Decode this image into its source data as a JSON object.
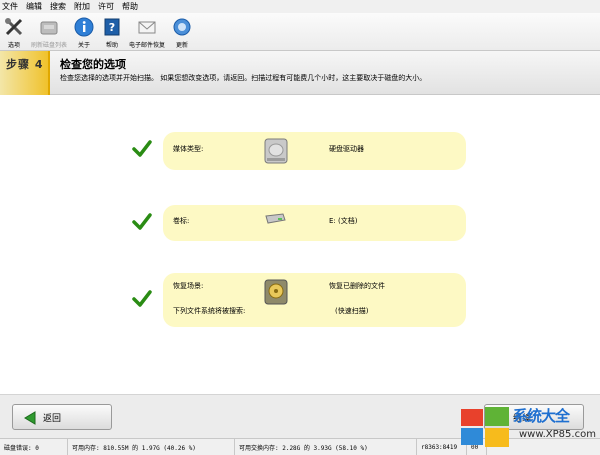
{
  "menu": [
    "文件",
    "编辑",
    "搜索",
    "附加",
    "许可",
    "帮助"
  ],
  "toolbar": {
    "options": "选项",
    "refresh_disks": "刷新磁盘列表",
    "about": "关于",
    "help": "帮助",
    "email_support": "电子邮件恢复",
    "update": "更新"
  },
  "step": {
    "number": "步骤 4",
    "title": "检查您的选项",
    "description": "检查您选择的选项并开始扫描。 如果您想改变选项，请返回。扫描过程有可能费几个小时，这主要取决于磁盘的大小。"
  },
  "summary": {
    "media": {
      "label": "媒体类型:",
      "value": "硬盘驱动器"
    },
    "volume": {
      "label": "卷标:",
      "value": "E: (文档)"
    },
    "scenario": {
      "label": "恢复场景:",
      "value": "恢复已删除的文件",
      "fs_label": "下列文件系统将被搜索:",
      "fs_value": "(快速扫描)"
    }
  },
  "buttons": {
    "back": "返回",
    "next": "继续"
  },
  "status": {
    "disk_errors": "磁盘错误: 0",
    "memory": "可用内存: 810.55M 的 1.97G (40.26 %)",
    "swap": "可用交换内存: 2.28G 的 3.93G (58.10 %)",
    "build": "r8363:8419",
    "page": "00"
  },
  "watermark": {
    "brand": "系统大全",
    "site": "www.XP85.com"
  },
  "colors": {
    "check": "#2a8c14",
    "pill": "#fdf9c4",
    "step_accent": "#f0c22c",
    "brand": "#1e6fd0"
  }
}
